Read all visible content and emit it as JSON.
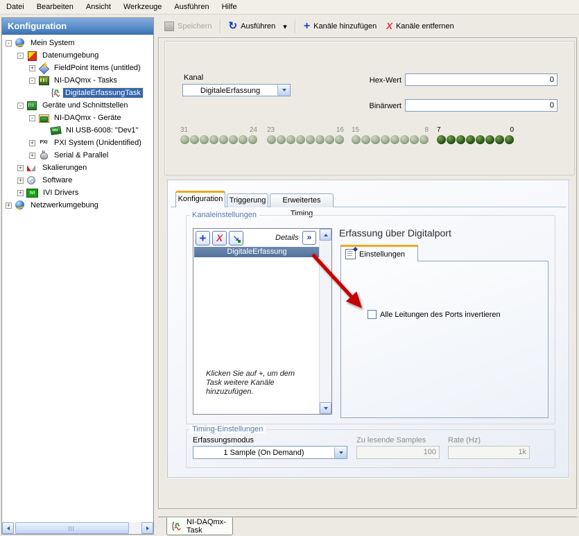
{
  "menu": {
    "items": [
      "Datei",
      "Bearbeiten",
      "Ansicht",
      "Werkzeuge",
      "Ausführen",
      "Hilfe"
    ]
  },
  "sidebar": {
    "title": "Konfiguration",
    "tree": [
      {
        "label": "Mein System",
        "exp": "-"
      },
      {
        "label": "Datenumgebung",
        "exp": "-"
      },
      {
        "label": "FieldPoint Items (untitled)",
        "exp": "+"
      },
      {
        "label": "NI-DAQmx - Tasks",
        "exp": "-"
      },
      {
        "label": "DigitaleErfassungTask",
        "exp": ""
      },
      {
        "label": "Geräte und Schnittstellen",
        "exp": "-"
      },
      {
        "label": "NI-DAQmx - Geräte",
        "exp": "-"
      },
      {
        "label": "NI USB-6008: \"Dev1\"",
        "exp": ""
      },
      {
        "label": "PXI System (Unidentified)",
        "exp": "+"
      },
      {
        "label": "Serial & Parallel",
        "exp": "+"
      },
      {
        "label": "Skalierungen",
        "exp": "+"
      },
      {
        "label": "Software",
        "exp": "+"
      },
      {
        "label": "IVI Drivers",
        "exp": "+"
      },
      {
        "label": "Netzwerkumgebung",
        "exp": "+"
      }
    ],
    "pxi_icon_text": "PXI",
    "ivi_icon_text": "IVI"
  },
  "toolbar": {
    "save_label": "Speichern",
    "run_label": "Ausführen",
    "run_icon": "↻",
    "caret_icon": "▾",
    "add_icon": "+",
    "add_label": "Kanäle hinzufügen",
    "remove_icon": "X",
    "remove_label": "Kanäle entfernen"
  },
  "top_panel": {
    "kanal_label": "Kanal",
    "kanal_value": "DigitaleErfassung",
    "hex_label": "Hex-Wert",
    "hex_value": "0",
    "bin_label": "Binärwert",
    "bin_value": "0",
    "led_groups": [
      {
        "left": "31",
        "right": "24",
        "state": "off"
      },
      {
        "left": "23",
        "right": "16",
        "state": "off"
      },
      {
        "left": "15",
        "right": "8",
        "state": "off"
      },
      {
        "left": "7",
        "right": "0",
        "state": "on"
      }
    ]
  },
  "tabs": {
    "config": "Konfiguration",
    "trigger": "Triggerung",
    "advanced": "Erweitertes Timing"
  },
  "channel_settings": {
    "group_label": "Kanaleinstellungen",
    "add_icon": "+",
    "remove_icon": "X",
    "assign_icon": "↘",
    "details_label": "Details",
    "details_icon": "»",
    "selected_channel": "DigitaleErfassung",
    "hint": "Klicken Sie auf +, um dem Task weitere Kanäle hinzuzufügen."
  },
  "acquisition": {
    "heading": "Erfassung über Digitalport",
    "tab_label": "Einstellungen",
    "invert_checkbox_label": "Alle Leitungen des Ports invertieren"
  },
  "timing": {
    "group_label": "Timing-Einstellungen",
    "mode_label": "Erfassungsmodus",
    "mode_value": "1 Sample (On Demand)",
    "samples_label": "Zu lesende Samples",
    "samples_value": "100",
    "rate_label": "Rate (Hz)",
    "rate_value": "1k"
  },
  "bottom_tab": {
    "label": "NI-DAQmx-Task"
  },
  "colors": {
    "selection": "#3565b0",
    "led_on": "#2d5a1b",
    "led_off": "#9cab8e",
    "arrow": "#c40000",
    "tab_accent": "#f2a71f"
  }
}
